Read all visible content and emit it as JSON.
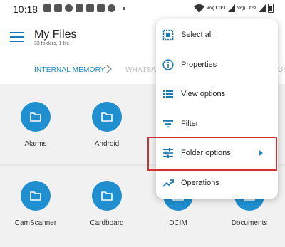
{
  "status_bar": {
    "time": "10:18",
    "carrier1": "Vo)) LTE1",
    "carrier2": "Vo)) LTE2"
  },
  "app_bar": {
    "title": "My Files",
    "subtitle": "33 folders, 1 file"
  },
  "breadcrumb": {
    "items": [
      "INTERNAL MEMORY",
      "WHATSAPP",
      "US"
    ]
  },
  "folders": [
    {
      "label": "Alarms"
    },
    {
      "label": "Android"
    },
    {
      "label": "CamScanner"
    },
    {
      "label": "Cardboard"
    },
    {
      "label": "DCIM"
    },
    {
      "label": "Documents"
    }
  ],
  "menu": {
    "items": [
      {
        "label": "Select all",
        "icon": "select-all-icon"
      },
      {
        "label": "Properties",
        "icon": "info-icon"
      },
      {
        "label": "View options",
        "icon": "view-list-icon"
      },
      {
        "label": "Filter",
        "icon": "filter-icon"
      },
      {
        "label": "Folder options",
        "icon": "tune-icon",
        "submenu": true
      },
      {
        "label": "Operations",
        "icon": "trending-icon"
      }
    ]
  },
  "colors": {
    "accent": "#1f8fcf",
    "highlight": "#d32f2f"
  }
}
